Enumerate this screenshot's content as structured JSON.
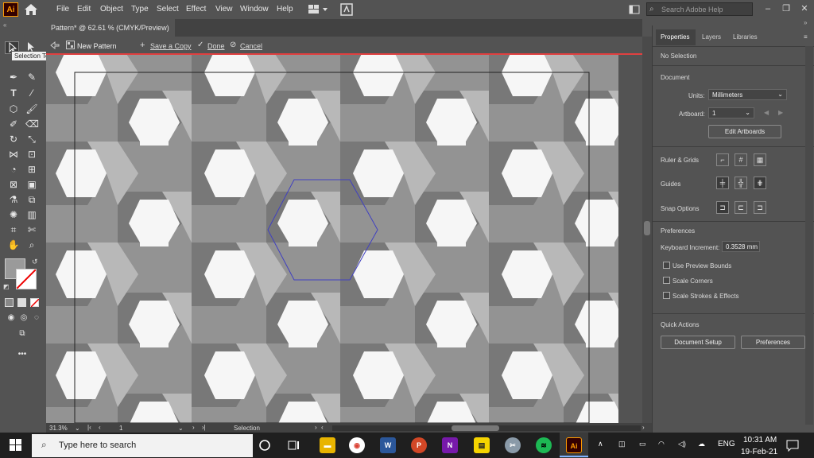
{
  "app": {
    "logo": "Ai",
    "accent": "#ff9a00"
  },
  "menu": [
    "File",
    "Edit",
    "Object",
    "Type",
    "Select",
    "Effect",
    "View",
    "Window",
    "Help"
  ],
  "search": {
    "placeholder": "Search Adobe Help"
  },
  "document": {
    "tab_title": "Pattern* @ 62.61 % (CMYK/Preview)"
  },
  "pattern_bar": {
    "name": "New Pattern",
    "save_copy": "Save a Copy",
    "done": "Done",
    "cancel": "Cancel"
  },
  "tooltip": "Selection Tool (V)",
  "status": {
    "zoom": "31.3%",
    "page": "1",
    "mode": "Selection"
  },
  "panel": {
    "tabs": [
      "Properties",
      "Layers",
      "Libraries"
    ],
    "selection": "No Selection",
    "document_label": "Document",
    "units_label": "Units:",
    "units_value": "Millimeters",
    "artboard_label": "Artboard:",
    "artboard_value": "1",
    "edit_artboards": "Edit Artboards",
    "ruler_grids": "Ruler & Grids",
    "guides": "Guides",
    "snap_options": "Snap Options",
    "preferences_label": "Preferences",
    "keyboard_increment_label": "Keyboard Increment:",
    "keyboard_increment_value": "0.3528 mm",
    "use_preview_bounds": "Use Preview Bounds",
    "scale_corners": "Scale Corners",
    "scale_strokes": "Scale Strokes & Effects",
    "quick_actions": "Quick Actions",
    "document_setup": "Document Setup",
    "preferences_btn": "Preferences"
  },
  "taskbar": {
    "search_placeholder": "Type here to search",
    "language": "ENG",
    "time": "10:31 AM",
    "date": "19-Feb-21"
  },
  "colors": {
    "hex_dark": "#7a7a7a",
    "hex_mid": "#969696",
    "hex_light": "#bdbdbd",
    "selection_outline": "#4040c0"
  }
}
